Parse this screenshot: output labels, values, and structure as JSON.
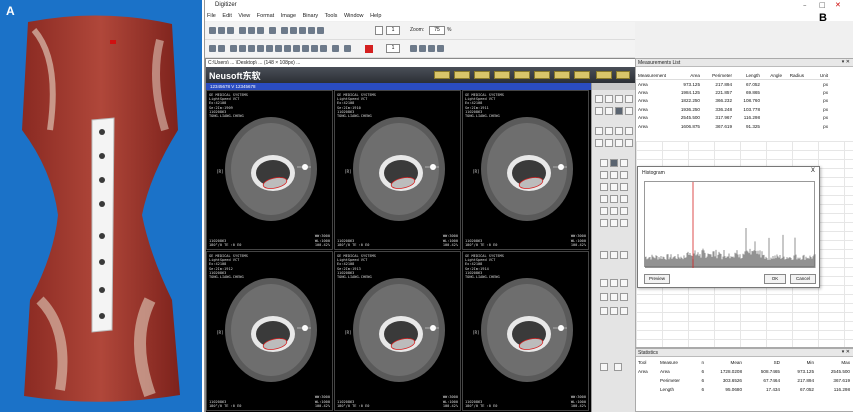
{
  "panel_a": {
    "letter": "A"
  },
  "panel_b": {
    "letter": "B"
  },
  "window": {
    "title": "Digitizer",
    "menu": [
      "File",
      "Edit",
      "View",
      "Format",
      "Image",
      "Binary",
      "Tools",
      "Window",
      "Help"
    ],
    "zoom_label": "Zoom:",
    "zoom_value": "75",
    "zoom_unit": "%",
    "spin_value_1": "1",
    "spin_value_2": "1",
    "path": "C:\\Users\\ ... \\Desktop\\ ... (148 × 108px) ...",
    "colors": {
      "accent_red": "#d42020",
      "series_bar": "#2a4cc0"
    }
  },
  "viewer": {
    "brand": "Neusoft东软",
    "series_label": "12345678 V 12345678",
    "cells": [
      {
        "info": "GE MEDICAL SYSTEMS\nLightSpeed VCT\nEx:42108\nSe:2Im:1909\n11020863\nTONG.LIANG.CHENG",
        "rlabel": "[R]",
        "bl": "11020863\n180°/0 TE :0 E0",
        "br": "WW:3000\nWL:1000\n100.42%"
      },
      {
        "info": "GE MEDICAL SYSTEMS\nLightSpeed VCT\nEx:42108\nSe:2Im:1910\n11020863\nTONG.LIANG.CHENG",
        "rlabel": "[R]",
        "bl": "11020863\n180°/0 TE :0 E0",
        "br": "WW:3000\nWL:1000\n100.42%"
      },
      {
        "info": "GE MEDICAL SYSTEMS\nLightSpeed VCT\nEx:42108\nSe:2Im:1911\n11020863\nTONG.LIANG.CHENG",
        "rlabel": "[R]",
        "bl": "11020863\n180°/0 TE :0 E0",
        "br": "WW:3000\nWL:1000\n100.42%"
      },
      {
        "info": "GE MEDICAL SYSTEMS\nLightSpeed VCT\nEx:42108\nSe:2Im:1912\n11020863\nTONG.LIANG.CHENG",
        "rlabel": "[R]",
        "bl": "11020863\n180°/0 TE :0 E0",
        "br": "WW:3000\nWL:1000\n100.42%"
      },
      {
        "info": "GE MEDICAL SYSTEMS\nLightSpeed VCT\nEx:42108\nSe:2Im:1913\n11020863\nTONG.LIANG.CHENG",
        "rlabel": "[R]",
        "bl": "11020863\n180°/0 TE :0 E0",
        "br": "WW:3000\nWL:1000\n100.42%"
      },
      {
        "info": "GE MEDICAL SYSTEMS\nLightSpeed VCT\nEx:42108\nSe:2Im:1914\n11020863\nTONG.LIANG.CHENG",
        "rlabel": "[R]",
        "bl": "11020863\n180°/0 TE :0 E0",
        "br": "WW:3000\nWL:1000\n100.42%"
      }
    ]
  },
  "measurements": {
    "title": "Measurements List",
    "headers": [
      "Measurement",
      "Area",
      "Perimeter",
      "Length",
      "Angle",
      "Radius",
      "Unit"
    ],
    "rows": [
      [
        "Area",
        "973.125",
        "217.894",
        "67.052",
        "",
        "",
        "px"
      ],
      [
        "Area",
        "1984.125",
        "221.857",
        "69.865",
        "",
        "",
        "px"
      ],
      [
        "Area",
        "1822.250",
        "366.232",
        "108.760",
        "",
        "",
        "px"
      ],
      [
        "Area",
        "1936.250",
        "336.248",
        "103.778",
        "",
        "",
        "px"
      ],
      [
        "Area",
        "2545.500",
        "317.967",
        "116.298",
        "",
        "",
        "px"
      ],
      [
        "Area",
        "1606.875",
        "367.619",
        "91.325",
        "",
        "",
        "px"
      ]
    ]
  },
  "histogram": {
    "title": "Histogram",
    "preview_label": "Preview",
    "ok_label": "OK",
    "cancel_label": "Cancel"
  },
  "statistics": {
    "title": "Statistics",
    "headers": [
      "Tool",
      "Measure",
      "n",
      "Mean",
      "SD",
      "Min",
      "Max"
    ],
    "rows": [
      [
        "Area",
        "Area",
        "6",
        "1728.0208",
        "508.7465",
        "973.125",
        "2545.500"
      ],
      [
        "",
        "Perimeter",
        "6",
        "303.6526",
        "67.7464",
        "217.894",
        "367.619"
      ],
      [
        "",
        "Length",
        "6",
        "95.0680",
        "17.434",
        "67.052",
        "116.298"
      ]
    ]
  }
}
